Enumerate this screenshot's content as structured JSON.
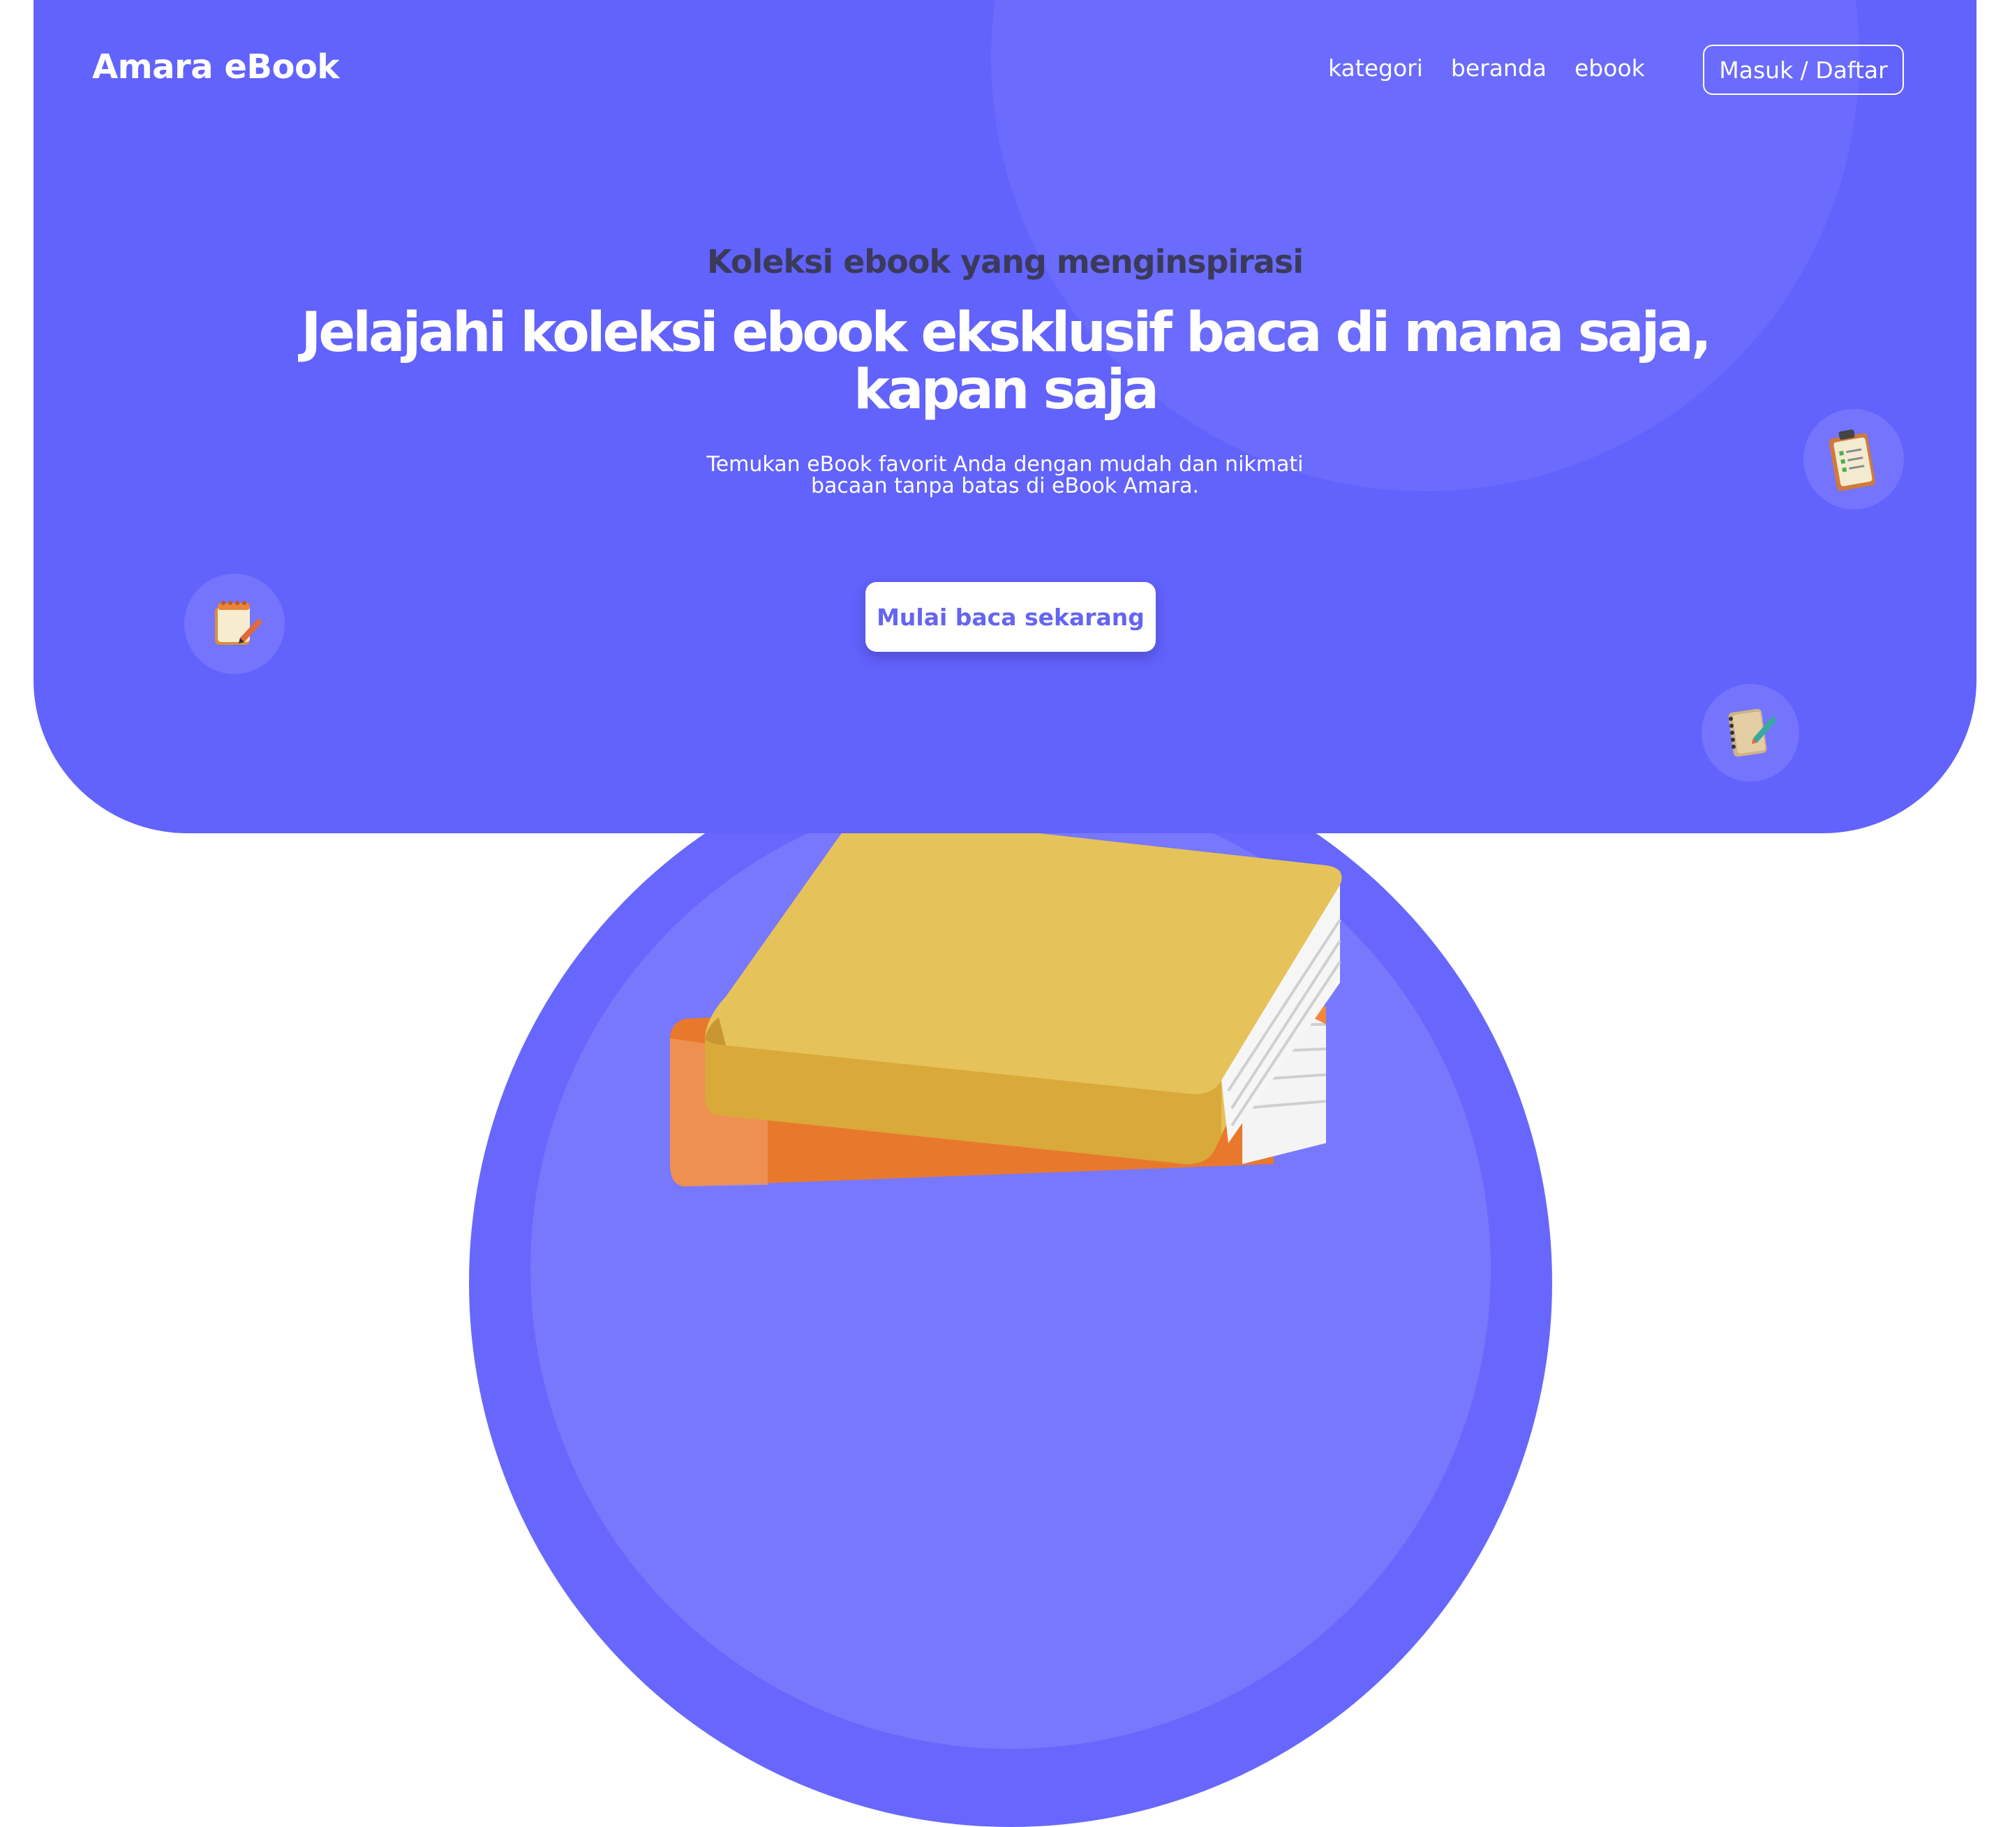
{
  "brand": "Amara eBook",
  "nav": {
    "items": [
      "kategori",
      "beranda",
      "ebook"
    ],
    "login_label": "Masuk / Daftar"
  },
  "hero": {
    "eyebrow": "Koleksi ebook yang menginspirasi",
    "headline": "Jelajahi koleksi ebook eksklusif baca di mana saja, kapan saja",
    "subtext": "Temukan eBook favorit Anda dengan mudah dan nikmati bacaan tanpa batas di eBook Amara.",
    "cta_label": "Mulai baca sekarang"
  },
  "icons": {
    "notepad": "notepad-icon",
    "clipboard": "clipboard-icon",
    "notebook": "notebook-icon",
    "books": "books-illustration"
  },
  "colors": {
    "hero_bg": "#6262fd",
    "accent": "#6565f0",
    "text_light": "#ffffff",
    "eyebrow_text": "#3a3a5a"
  }
}
